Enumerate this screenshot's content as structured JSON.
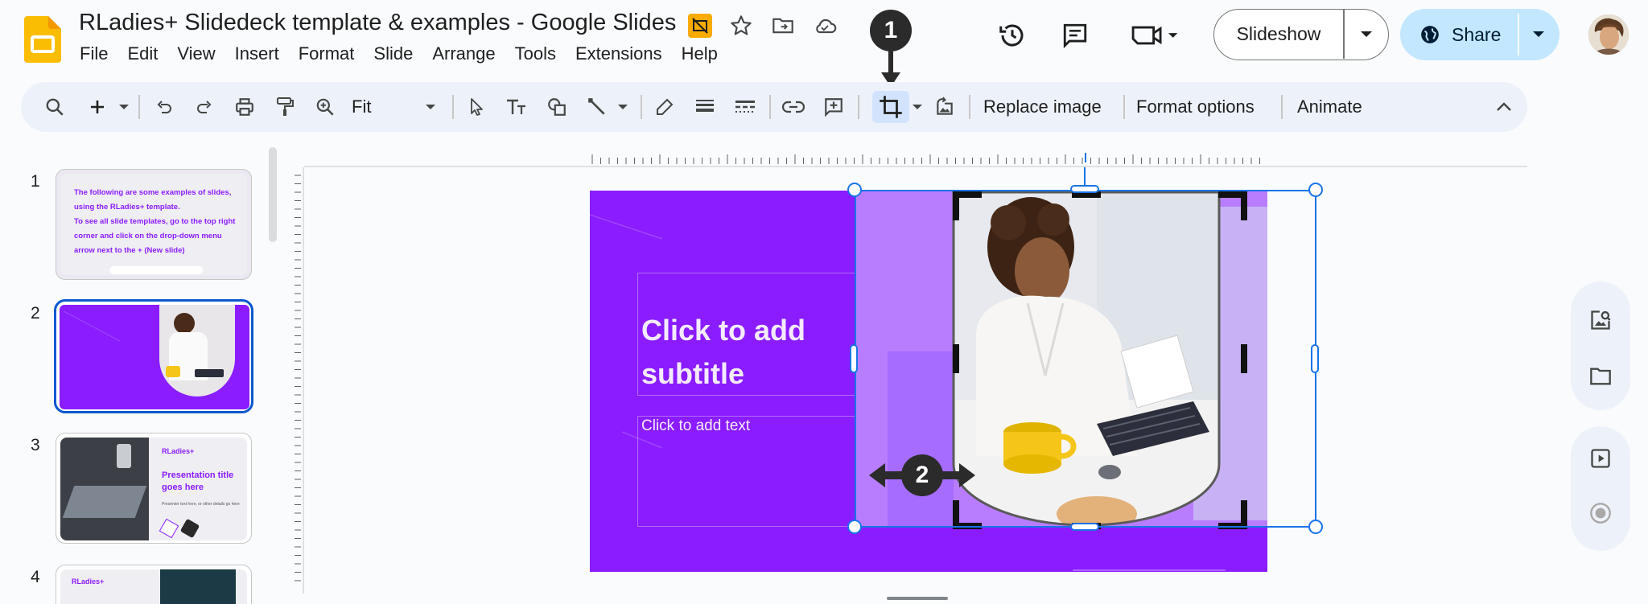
{
  "app": {
    "title": "RLadies+ Slidedeck template & examples - Google Slides",
    "menu": [
      "File",
      "Edit",
      "View",
      "Insert",
      "Format",
      "Slide",
      "Arrange",
      "Tools",
      "Extensions",
      "Help"
    ]
  },
  "header": {
    "slideshow_label": "Slideshow",
    "share_label": "Share"
  },
  "toolbar": {
    "zoom_value": "Fit",
    "replace_image_label": "Replace image",
    "format_options_label": "Format options",
    "animate_label": "Animate"
  },
  "filmstrip": {
    "slides": [
      {
        "number": "1",
        "text": [
          "The following are some examples of slides,",
          "using the RLadies+ template.",
          "To see all slide templates, go to the top right",
          "corner and click on the drop-down menu",
          "arrow next to the + (New slide)"
        ]
      },
      {
        "number": "2"
      },
      {
        "number": "3",
        "brand": "RLadies+",
        "title": "Presentation title goes here",
        "subtitle": "Presenter text here, or other details go here"
      },
      {
        "number": "4",
        "brand": "RLadies+"
      }
    ]
  },
  "slide": {
    "subtitle_placeholder": "Click to add subtitle",
    "body_placeholder": "Click to add text"
  },
  "callouts": {
    "first": "1",
    "second": "2"
  },
  "colors": {
    "slide_bg": "#8a1cff",
    "selection": "#1a73e8",
    "share_bg": "#c2e7ff",
    "crop_active": "#d3e3fd"
  }
}
